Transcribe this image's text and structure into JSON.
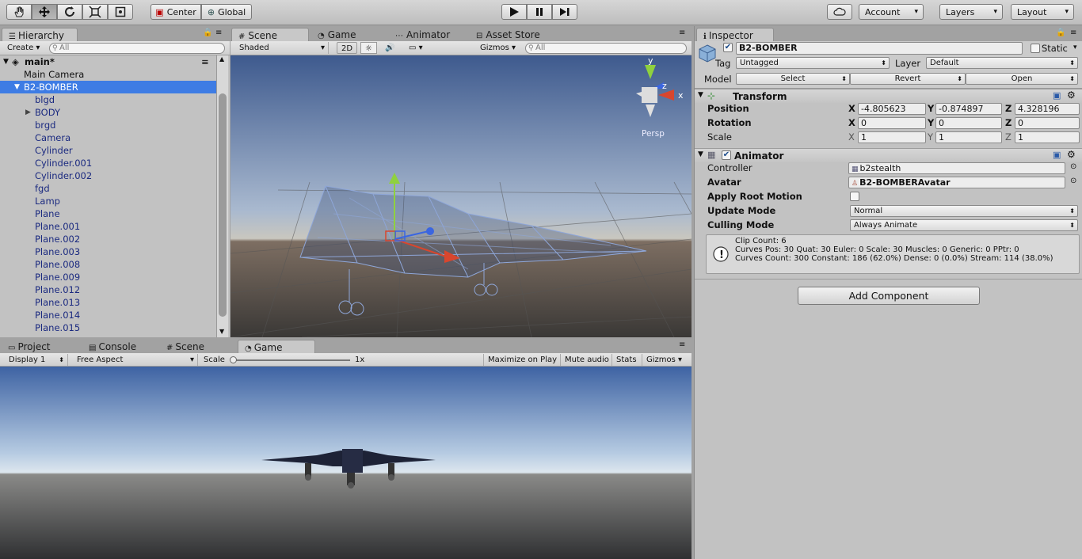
{
  "toolbar": {
    "pivot_center": "Center",
    "pivot_global": "Global",
    "account": "Account",
    "layers": "Layers",
    "layout": "Layout"
  },
  "hierarchy": {
    "tab": "Hierarchy",
    "create": "Create",
    "search_placeholder": "All",
    "scene_name": "main*",
    "items": [
      {
        "label": "Main Camera"
      },
      {
        "label": "B2-BOMBER"
      },
      {
        "label": "blgd"
      },
      {
        "label": "BODY"
      },
      {
        "label": "brgd"
      },
      {
        "label": "Camera"
      },
      {
        "label": "Cylinder"
      },
      {
        "label": "Cylinder.001"
      },
      {
        "label": "Cylinder.002"
      },
      {
        "label": "fgd"
      },
      {
        "label": "Lamp"
      },
      {
        "label": "Plane"
      },
      {
        "label": "Plane.001"
      },
      {
        "label": "Plane.002"
      },
      {
        "label": "Plane.003"
      },
      {
        "label": "Plane.008"
      },
      {
        "label": "Plane.009"
      },
      {
        "label": "Plane.012"
      },
      {
        "label": "Plane.013"
      },
      {
        "label": "Plane.014"
      },
      {
        "label": "Plane.015"
      }
    ]
  },
  "scene_view": {
    "tabs": [
      "Scene",
      "Game",
      "Animator",
      "Asset Store"
    ],
    "shading": "Shaded",
    "mode_2d": "2D",
    "gizmos": "Gizmos",
    "search_placeholder": "All",
    "persp": "Persp",
    "axis_y": "y",
    "axis_z": "z",
    "axis_x": "x"
  },
  "bottom": {
    "tabs": [
      "Project",
      "Console",
      "Scene",
      "Game"
    ],
    "display": "Display 1",
    "aspect": "Free Aspect",
    "scale_label": "Scale",
    "scale_value": "1x",
    "maximize": "Maximize on Play",
    "mute": "Mute audio",
    "stats": "Stats",
    "gizmos": "Gizmos"
  },
  "inspector": {
    "tab": "Inspector",
    "object_name": "B2-BOMBER",
    "static_label": "Static",
    "tag_label": "Tag",
    "tag_value": "Untagged",
    "layer_label": "Layer",
    "layer_value": "Default",
    "model_label": "Model",
    "model_select": "Select",
    "model_revert": "Revert",
    "model_open": "Open",
    "transform": {
      "title": "Transform",
      "position_label": "Position",
      "rotation_label": "Rotation",
      "scale_label": "Scale",
      "x": "X",
      "y": "Y",
      "z": "Z",
      "position": [
        "-4.805623",
        "-0.874897",
        "4.328196"
      ],
      "rotation": [
        "0",
        "0",
        "0"
      ],
      "scale": [
        "1",
        "1",
        "1"
      ]
    },
    "animator": {
      "title": "Animator",
      "controller_label": "Controller",
      "controller_value": "b2stealth",
      "avatar_label": "Avatar",
      "avatar_value": "B2-BOMBERAvatar",
      "root_motion_label": "Apply Root Motion",
      "update_mode_label": "Update Mode",
      "update_mode_value": "Normal",
      "culling_mode_label": "Culling Mode",
      "culling_mode_value": "Always Animate",
      "info_line1": "Clip Count: 6",
      "info_line2": "Curves Pos: 30 Quat: 30 Euler: 0 Scale: 30 Muscles: 0 Generic: 0 PPtr: 0",
      "info_line3": "Curves Count: 300 Constant: 186 (62.0%) Dense: 0 (0.0%) Stream: 114 (38.0%)"
    },
    "add_component": "Add Component"
  }
}
